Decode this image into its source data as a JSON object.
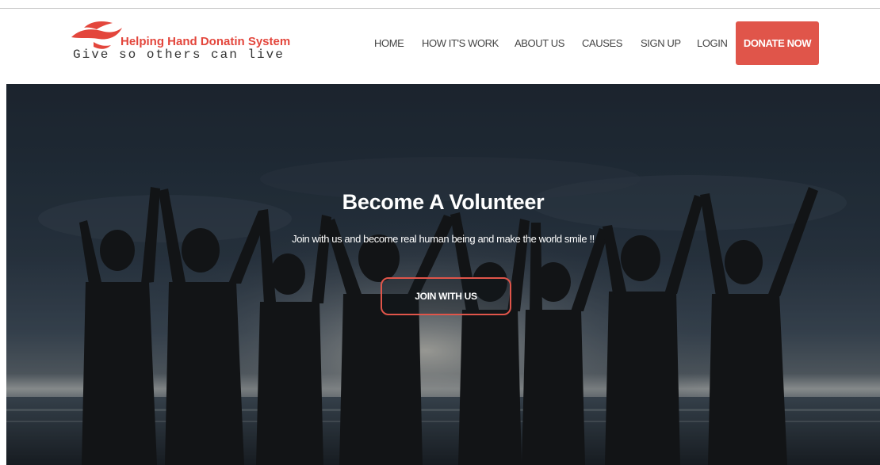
{
  "header": {
    "logo": {
      "title": "Helping Hand Donatin System",
      "tagline": "Give so others can live",
      "brand_color": "#e3463c"
    },
    "nav": [
      {
        "label": "HOME"
      },
      {
        "label": "HOW IT'S WORK"
      },
      {
        "label": "ABOUT US"
      },
      {
        "label": "CAUSES"
      },
      {
        "label": "SIGN UP"
      },
      {
        "label": "LOGIN"
      }
    ],
    "donate_label": "DONATE NOW",
    "accent_color": "#e0554a"
  },
  "hero": {
    "title": "Become A Volunteer",
    "subtitle": "Join with us and become real human being and make the world smile !!",
    "button_label": "JOIN WITH US",
    "background": "silhouettes-of-people-raising-joined-hands-at-sunset-beach"
  }
}
